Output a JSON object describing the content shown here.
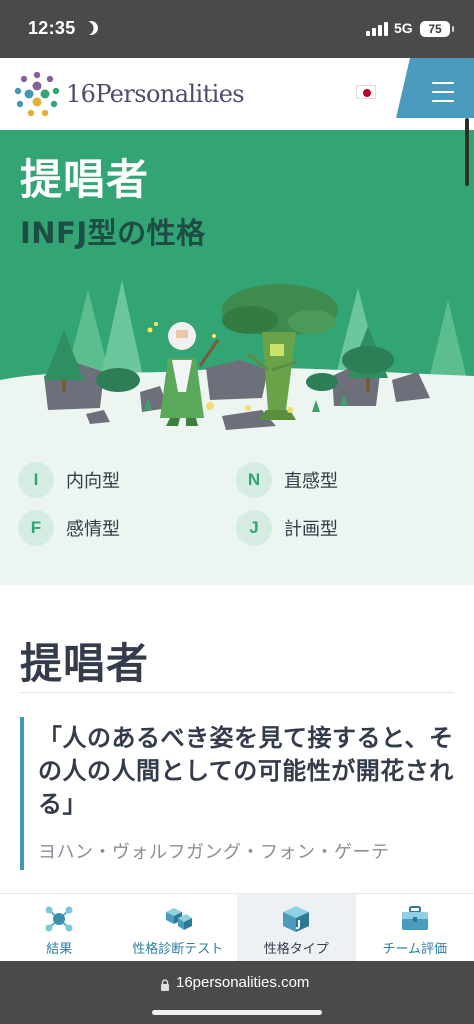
{
  "status_bar": {
    "time": "12:35",
    "network": "5G",
    "battery": "75"
  },
  "header": {
    "logo_text": "16Personalities"
  },
  "hero": {
    "title": "提唱者",
    "subtitle": "INFJ型の性格"
  },
  "traits": [
    {
      "letter": "I",
      "label": "内向型"
    },
    {
      "letter": "N",
      "label": "直感型"
    },
    {
      "letter": "F",
      "label": "感情型"
    },
    {
      "letter": "J",
      "label": "計画型"
    }
  ],
  "content": {
    "section_title": "提唱者",
    "quote": "「人のあるべき姿を見て接すると、その人の人間としての可能性が開花される」",
    "quote_author": "ヨハン・ヴォルフガング・フォン・ゲーテ"
  },
  "tabbar": {
    "tabs": [
      {
        "label": "結果",
        "icon": "molecule-icon",
        "active": false
      },
      {
        "label": "性格診断テスト",
        "icon": "cubes-icon",
        "active": false
      },
      {
        "label": "性格タイプ",
        "icon": "cube-icon",
        "active": true
      },
      {
        "label": "チーム評価",
        "icon": "briefcase-icon",
        "active": false
      }
    ]
  },
  "browser": {
    "url": "16personalities.com"
  },
  "colors": {
    "hero_green": "#33a474",
    "accent_blue": "#4298b4",
    "header_tab_blue": "#4a9bbd",
    "text_dark": "#343c4b"
  }
}
